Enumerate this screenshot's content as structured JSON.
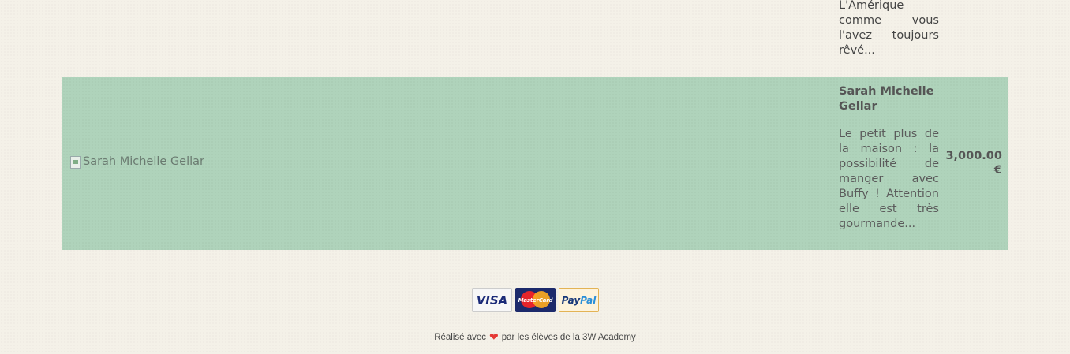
{
  "previous_product": {
    "description": "L'Amérique comme vous l'avez toujours rêvé..."
  },
  "product": {
    "image_alt": "Sarah Michelle Gellar",
    "name": "Sarah Michelle Gellar",
    "description": "Le petit plus de la maison : la possibilité de manger avec Buffy ! Attention elle est très gourmande...",
    "price": "3,000.00 €",
    "row_color": "#afd3bb"
  },
  "payments": [
    {
      "name": "visa",
      "label": "VISA"
    },
    {
      "name": "mastercard",
      "label": "MasterCard"
    },
    {
      "name": "paypal",
      "label_a": "Pay",
      "label_b": "Pal"
    }
  ],
  "footer": {
    "text_before": "Réalisé avec",
    "heart": "❤",
    "text_after": "par les élèves de la 3W Academy"
  }
}
